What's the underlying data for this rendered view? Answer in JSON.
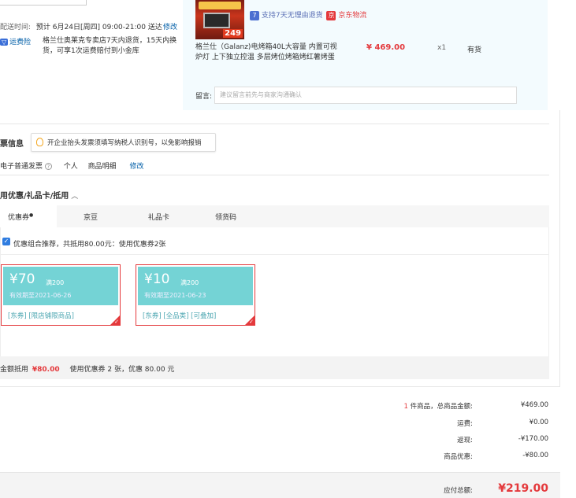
{
  "shipping": {
    "delivery_label": "配送时间:",
    "delivery_value": "预计 6月24日[周四] 09:00-21:00 送达",
    "modify": "修改",
    "freight_badge": "运费险",
    "freight_text_1": "格兰仕奥莱克专卖店7天内退货，15天内换",
    "freight_text_2": "货，可享1次运费赔付到小金库"
  },
  "product": {
    "img_tag": "249",
    "service_7day": "支持7天无理由退货",
    "jd_logistics": "京东物流",
    "name_1": "格兰仕（Galanz)电烤箱40L大容量 内置可视",
    "name_2": "炉灯 上下独立控温 多层烤位烤箱烤红薯烤蛋",
    "price": "¥ 469.00",
    "qty": "x1",
    "stock": "有货",
    "remark_label": "留言:",
    "remark_placeholder": "建议留言前先与商家沟通确认"
  },
  "invoice": {
    "title": "票信息",
    "tip": "开企业抬头发票须填写纳税人识别号，以免影响报销",
    "type": "电子普通发票",
    "personal": "个人",
    "detail": "商品明细",
    "modify": "修改"
  },
  "discount": {
    "title": "用优惠/礼品卡/抵用",
    "tabs": [
      "优惠券",
      "京豆",
      "礼品卡",
      "领货码"
    ],
    "recommend": "优惠组合推荐，共抵用80.00元：使用优惠券2张",
    "coupons": [
      {
        "amount": "¥70",
        "cond": "满200",
        "expire": "有效期至2021-06-26",
        "tags": "[东券]  [限店铺限商品]"
      },
      {
        "amount": "¥10",
        "cond": "满200",
        "expire": "有效期至2021-06-23",
        "tags": "[东券]  [全品类]  [可叠加]"
      }
    ],
    "summary_label": "金额抵用",
    "summary_amount": "¥80.00",
    "summary_detail": "使用优惠券 2 张，优惠 80.00 元"
  },
  "totals": {
    "count_num": "1",
    "count_text": "件商品，总商品金额:",
    "goods_total": "¥469.00",
    "freight_label": "运费:",
    "freight": "¥0.00",
    "rebate_label": "返现:",
    "rebate": "-¥170.00",
    "discount_label": "商品优惠:",
    "discount": "-¥80.00",
    "payable_label": "应付总额:",
    "payable": "¥219.00"
  },
  "colors": {
    "accent": "#e4393c",
    "link": "#005ea7",
    "coupon": "#74d3d5"
  }
}
